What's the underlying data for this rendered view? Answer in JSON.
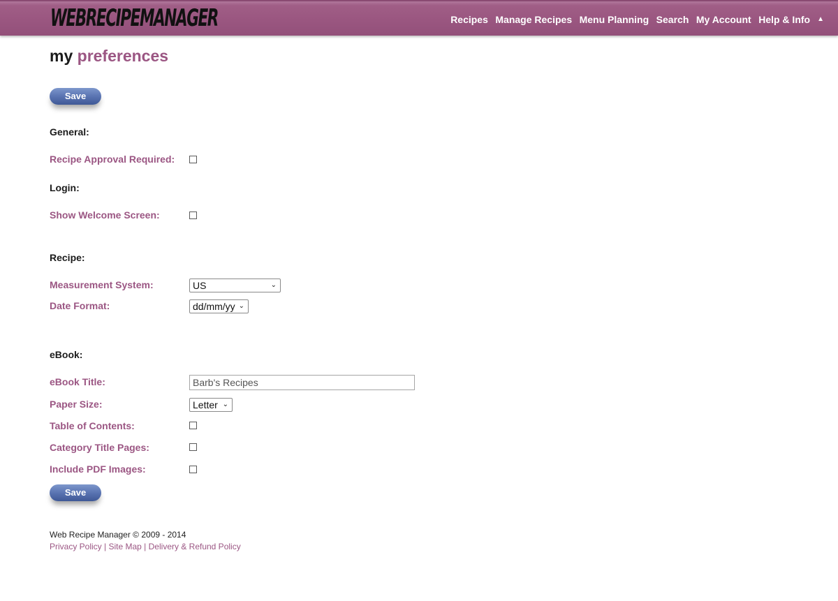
{
  "header": {
    "logo_text": "WEBRECIPEMANAGER",
    "nav": [
      "Recipes",
      "Manage Recipes",
      "Menu Planning",
      "Search",
      "My Account",
      "Help & Info"
    ],
    "caret_icon": "chevron-up-icon"
  },
  "page": {
    "title_prefix": "my",
    "title_accent": "preferences",
    "save_label": "Save"
  },
  "general": {
    "heading": "General:",
    "recipe_approval_label": "Recipe Approval Required:",
    "recipe_approval_checked": false
  },
  "login": {
    "heading": "Login:",
    "welcome_label": "Show Welcome Screen:",
    "welcome_checked": false
  },
  "recipe": {
    "heading": "Recipe:",
    "measurement_label": "Measurement System:",
    "measurement_value": "US",
    "date_label": "Date Format:",
    "date_value": "dd/mm/yy"
  },
  "ebook": {
    "heading": "eBook:",
    "title_label": "eBook Title:",
    "title_value": "Barb's Recipes",
    "paper_label": "Paper Size:",
    "paper_value": "Letter",
    "toc_label": "Table of Contents:",
    "category_label": "Category Title Pages:",
    "pdf_images_label": "Include PDF Images:"
  },
  "footer": {
    "copyright": "Web Recipe Manager © 2009 - 2014",
    "links": [
      "Privacy Policy",
      "Site Map",
      "Delivery & Refund Policy"
    ],
    "separator": " | "
  },
  "colors": {
    "header_bg": "#9a5680",
    "accent": "#9b5683",
    "button": "#5a74b2"
  }
}
